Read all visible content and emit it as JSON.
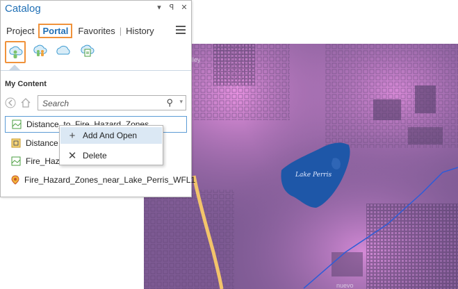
{
  "pane": {
    "title": "Catalog",
    "controls": [
      "▾",
      "⊞",
      "✕"
    ],
    "tabs": [
      {
        "label": "Project",
        "active": false
      },
      {
        "label": "Portal",
        "active": true
      },
      {
        "label": "Favorites",
        "active": false
      },
      {
        "label": "History",
        "active": false
      }
    ],
    "portal_icons": [
      "my-content-icon",
      "groups-icon",
      "all-portal-icon",
      "living-atlas-icon"
    ],
    "section_title": "My Content",
    "search_placeholder": "Search",
    "items": [
      {
        "label": "Distance_to_Fire_Hazard_Zones",
        "icon": "raster-layer-icon",
        "selected": true
      },
      {
        "label": "Distance",
        "icon": "map-package-icon",
        "selected": false
      },
      {
        "label": "Fire_Haz",
        "icon": "raster-layer-icon",
        "selected": false
      },
      {
        "label": "Fire_Hazard_Zones_near_Lake_Perris_WFL1",
        "icon": "feature-layer-icon",
        "selected": false
      }
    ]
  },
  "context_menu": {
    "items": [
      {
        "label": "Add And Open",
        "icon": "plus-icon",
        "highlighted": true
      },
      {
        "label": "Delete",
        "icon": "x-icon",
        "highlighted": false
      }
    ]
  },
  "map": {
    "lake_label": "Lake Perris",
    "partial_labels": [
      "lley",
      "nuevo"
    ],
    "colors": {
      "base": "#7d5a93",
      "pink": "#e58ee0",
      "lake": "#1e57a8",
      "road": "#f3c46b",
      "boundary": "#2d5cd8"
    }
  }
}
